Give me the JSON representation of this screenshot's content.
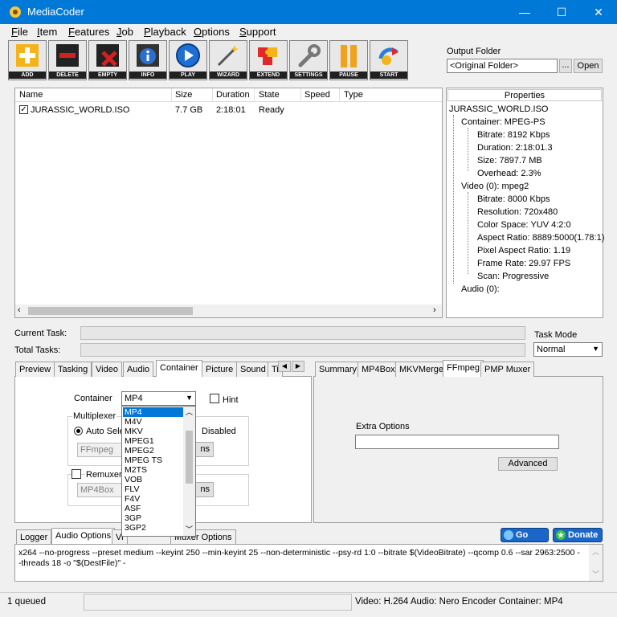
{
  "app": {
    "title": "MediaCoder",
    "window_controls": {
      "minimize": "—",
      "maximize": "☐",
      "close": "✕"
    }
  },
  "menu": [
    {
      "key": "F",
      "rest": "ile"
    },
    {
      "key": "I",
      "rest": "tem"
    },
    {
      "key": "F",
      "rest": "eatures"
    },
    {
      "key": "J",
      "rest": "ob"
    },
    {
      "key": "P",
      "rest": "layback"
    },
    {
      "key": "O",
      "rest": "ptions"
    },
    {
      "key": "S",
      "rest": "upport"
    }
  ],
  "toolbar": [
    {
      "label": "ADD",
      "color": "#f3b41b"
    },
    {
      "label": "DELETE",
      "color": "#d42020"
    },
    {
      "label": "EMPTY",
      "color": "#c61717"
    },
    {
      "label": "INFO",
      "color": "#2a6fd0"
    },
    {
      "label": "PLAY",
      "color": "#1d6fd6"
    },
    {
      "label": "WIZARD",
      "color": "#a0a0a0"
    },
    {
      "label": "EXTEND",
      "color": "#e02a2a"
    },
    {
      "label": "SETTINGS",
      "color": "#8c8c8c"
    },
    {
      "label": "PAUSE",
      "color": "#f1a21a"
    },
    {
      "label": "START",
      "color": "#2a7fd6"
    }
  ],
  "output_folder": {
    "label": "Output Folder",
    "value": "<Original Folder>",
    "browse_label": "...",
    "open_label": "Open"
  },
  "file_list": {
    "columns": [
      "Name",
      "Size",
      "Duration",
      "State",
      "Speed",
      "Type"
    ],
    "rows": [
      {
        "checked": true,
        "name": "JURASSIC_WORLD.ISO",
        "size": "7.7 GB",
        "duration": "2:18:01",
        "state": "Ready",
        "speed": "",
        "type": ""
      }
    ]
  },
  "properties": {
    "header": "Properties",
    "root": "JURASSIC_WORLD.ISO",
    "container": "Container: MPEG-PS",
    "container_items": [
      "Bitrate: 8192 Kbps",
      "Duration: 2:18:01.3",
      "Size: 7897.7 MB",
      "Overhead: 2.3%"
    ],
    "video": "Video (0): mpeg2",
    "video_items": [
      "Bitrate: 8000 Kbps",
      "Resolution: 720x480",
      "Color Space: YUV 4:2:0",
      "Aspect Ratio: 8889:5000(1.78:1)",
      "Pixel Aspect Ratio: 1.19",
      "Frame Rate: 29.97 FPS",
      "Scan: Progressive"
    ],
    "audio": "Audio (0):"
  },
  "tasks": {
    "current_label": "Current Task:",
    "total_label": "Total Tasks:",
    "mode_label": "Task Mode",
    "mode_value": "Normal"
  },
  "left_tabs": [
    "Preview",
    "Tasking",
    "Video",
    "Audio",
    "Container",
    "Picture",
    "Sound",
    "Ti"
  ],
  "right_tabs": [
    "Summary",
    "MP4Box",
    "MKVMerge",
    "FFmpeg",
    "PMP Muxer"
  ],
  "container_panel": {
    "container_label": "Container",
    "container_value": "MP4",
    "hint_label": "Hint",
    "multiplexer_label": "Multiplexer",
    "auto_select_label": "Auto Sele",
    "disabled_label": "Disabled",
    "mux_value": "FFmpeg",
    "options_partial": "ns",
    "remuxer_label": "Remuxer",
    "remux_value": "MP4Box",
    "options_partial2": "ns"
  },
  "dropdown_options": [
    "MP4",
    "M4V",
    "MKV",
    "MPEG1",
    "MPEG2",
    "MPEG TS",
    "M2TS",
    "VOB",
    "FLV",
    "F4V",
    "ASF",
    "3GP",
    "3GP2"
  ],
  "ffmpeg_panel": {
    "extra_options_label": "Extra Options",
    "extra_options_value": "",
    "advanced_label": "Advanced"
  },
  "bottom_tabs": [
    "Logger",
    "Audio Options",
    "Vi",
    "Muxer Options"
  ],
  "promo": {
    "gopro": "Go PRO",
    "donate": "Donate"
  },
  "command_line": "x264 --no-progress --preset medium --keyint 250 --min-keyint 25 --non-deterministic --psy-rd 1:0 --bitrate $(VideoBitrate) --qcomp 0.6 --sar 2963:2500 --threads 18 -o \"$(DestFile)\" -",
  "statusbar": {
    "queued": "1 queued",
    "middle": "",
    "summary": "Video: H.264  Audio: Nero Encoder  Container: MP4"
  }
}
